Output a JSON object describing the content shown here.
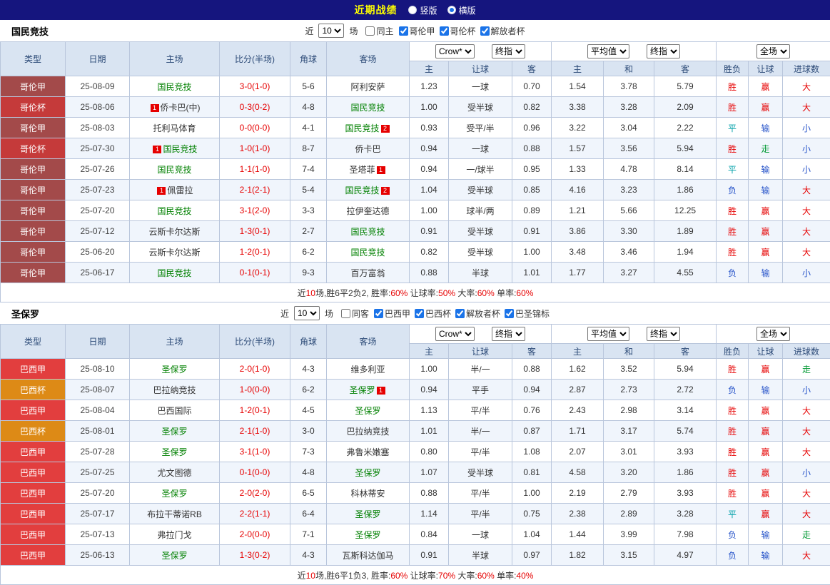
{
  "topbar": {
    "title": "近期战绩",
    "radios": [
      {
        "label": "竖版",
        "checked": false
      },
      {
        "label": "横版",
        "checked": true
      }
    ]
  },
  "colors": {
    "topbar_bg": "#15157E",
    "title_color": "#FFFF00",
    "focus_team": "#008000",
    "score": "#E60000",
    "league": {
      "哥伦甲": "#A34A4A",
      "哥伦杯": "#C53A3A",
      "巴西甲": "#E23E3E",
      "巴西杯": "#DD8A16"
    },
    "result": {
      "red": "#E60000",
      "blue": "#2653C9",
      "green": "#009933",
      "teal": "#00A0A8"
    }
  },
  "sections": [
    {
      "team": "国民竞技",
      "filter": {
        "prefix": "近",
        "count": "10",
        "suffix": "场",
        "same_label": "同主",
        "same_checked": false,
        "leagues": [
          {
            "label": "哥伦甲",
            "checked": true
          },
          {
            "label": "哥伦杯",
            "checked": true
          },
          {
            "label": "解放者杯",
            "checked": true
          }
        ]
      },
      "header": {
        "cols": [
          "类型",
          "日期",
          "主场",
          "比分(半场)",
          "角球",
          "客场"
        ],
        "group1": {
          "select1": "Crow*",
          "select2": "终指",
          "cols": [
            "主",
            "让球",
            "客"
          ]
        },
        "group2": {
          "select1": "平均值",
          "select2": "终指",
          "cols": [
            "主",
            "和",
            "客"
          ]
        },
        "group3": {
          "select": "全场",
          "cols": [
            "胜负",
            "让球",
            "进球数"
          ]
        }
      },
      "rows": [
        {
          "league": "哥伦甲",
          "date": "25-08-09",
          "home": {
            "name": "国民竞技",
            "focus": true
          },
          "score": "3-0(1-0)",
          "corner": "5-6",
          "away": {
            "name": "阿利安萨",
            "focus": false
          },
          "odds1": [
            "1.23",
            "一球",
            "0.70"
          ],
          "odds2": [
            "1.54",
            "3.78",
            "5.79"
          ],
          "results": [
            "胜",
            "赢",
            "大"
          ]
        },
        {
          "league": "哥伦杯",
          "date": "25-08-06",
          "home": {
            "name": "侨卡巴(中)",
            "focus": false,
            "badge": {
              "text": "1",
              "pos": "before"
            }
          },
          "score": "0-3(0-2)",
          "corner": "4-8",
          "away": {
            "name": "国民竞技",
            "focus": true
          },
          "odds1": [
            "1.00",
            "受半球",
            "0.82"
          ],
          "odds2": [
            "3.38",
            "3.28",
            "2.09"
          ],
          "results": [
            "胜",
            "赢",
            "大"
          ]
        },
        {
          "league": "哥伦甲",
          "date": "25-08-03",
          "home": {
            "name": "托利马体育",
            "focus": false
          },
          "score": "0-0(0-0)",
          "corner": "4-1",
          "away": {
            "name": "国民竞技",
            "focus": true,
            "badge": {
              "text": "2",
              "pos": "after"
            }
          },
          "odds1": [
            "0.93",
            "受平/半",
            "0.96"
          ],
          "odds2": [
            "3.22",
            "3.04",
            "2.22"
          ],
          "results": [
            "平",
            "输",
            "小"
          ]
        },
        {
          "league": "哥伦杯",
          "date": "25-07-30",
          "home": {
            "name": "国民竞技",
            "focus": true,
            "badge": {
              "text": "1",
              "pos": "before"
            }
          },
          "score": "1-0(1-0)",
          "corner": "8-7",
          "away": {
            "name": "侨卡巴",
            "focus": false
          },
          "odds1": [
            "0.94",
            "一球",
            "0.88"
          ],
          "odds2": [
            "1.57",
            "3.56",
            "5.94"
          ],
          "results": [
            "胜",
            "走",
            "小"
          ]
        },
        {
          "league": "哥伦甲",
          "date": "25-07-26",
          "home": {
            "name": "国民竞技",
            "focus": true
          },
          "score": "1-1(1-0)",
          "corner": "7-4",
          "away": {
            "name": "圣塔菲",
            "focus": false,
            "badge": {
              "text": "1",
              "pos": "after"
            }
          },
          "odds1": [
            "0.94",
            "一/球半",
            "0.95"
          ],
          "odds2": [
            "1.33",
            "4.78",
            "8.14"
          ],
          "results": [
            "平",
            "输",
            "小"
          ]
        },
        {
          "league": "哥伦甲",
          "date": "25-07-23",
          "home": {
            "name": "佩雷拉",
            "focus": false,
            "badge": {
              "text": "1",
              "pos": "before"
            }
          },
          "score": "2-1(2-1)",
          "corner": "5-4",
          "away": {
            "name": "国民竞技",
            "focus": true,
            "badge": {
              "text": "2",
              "pos": "after"
            }
          },
          "odds1": [
            "1.04",
            "受半球",
            "0.85"
          ],
          "odds2": [
            "4.16",
            "3.23",
            "1.86"
          ],
          "results": [
            "负",
            "输",
            "大"
          ]
        },
        {
          "league": "哥伦甲",
          "date": "25-07-20",
          "home": {
            "name": "国民竞技",
            "focus": true
          },
          "score": "3-1(2-0)",
          "corner": "3-3",
          "away": {
            "name": "拉伊奎达德",
            "focus": false
          },
          "odds1": [
            "1.00",
            "球半/两",
            "0.89"
          ],
          "odds2": [
            "1.21",
            "5.66",
            "12.25"
          ],
          "results": [
            "胜",
            "赢",
            "大"
          ]
        },
        {
          "league": "哥伦甲",
          "date": "25-07-12",
          "home": {
            "name": "云斯卡尔达斯",
            "focus": false
          },
          "score": "1-3(0-1)",
          "corner": "2-7",
          "away": {
            "name": "国民竞技",
            "focus": true
          },
          "odds1": [
            "0.91",
            "受半球",
            "0.91"
          ],
          "odds2": [
            "3.86",
            "3.30",
            "1.89"
          ],
          "results": [
            "胜",
            "赢",
            "大"
          ]
        },
        {
          "league": "哥伦甲",
          "date": "25-06-20",
          "home": {
            "name": "云斯卡尔达斯",
            "focus": false
          },
          "score": "1-2(0-1)",
          "corner": "6-2",
          "away": {
            "name": "国民竞技",
            "focus": true
          },
          "odds1": [
            "0.82",
            "受半球",
            "1.00"
          ],
          "odds2": [
            "3.48",
            "3.46",
            "1.94"
          ],
          "results": [
            "胜",
            "赢",
            "大"
          ]
        },
        {
          "league": "哥伦甲",
          "date": "25-06-17",
          "home": {
            "name": "国民竞技",
            "focus": true
          },
          "score": "0-1(0-1)",
          "corner": "9-3",
          "away": {
            "name": "百万富翁",
            "focus": false
          },
          "odds1": [
            "0.88",
            "半球",
            "1.01"
          ],
          "odds2": [
            "1.77",
            "3.27",
            "4.55"
          ],
          "results": [
            "负",
            "输",
            "小"
          ]
        }
      ],
      "summary": [
        {
          "text": "近"
        },
        {
          "text": "10",
          "red": true
        },
        {
          "text": "场,胜6平2负2, 胜率:"
        },
        {
          "text": "60%",
          "red": true
        },
        {
          "text": " 让球率:"
        },
        {
          "text": "50%",
          "red": true
        },
        {
          "text": " 大率:"
        },
        {
          "text": "60%",
          "red": true
        },
        {
          "text": " 单率:"
        },
        {
          "text": "60%",
          "red": true
        }
      ]
    },
    {
      "team": "圣保罗",
      "filter": {
        "prefix": "近",
        "count": "10",
        "suffix": "场",
        "same_label": "同客",
        "same_checked": false,
        "leagues": [
          {
            "label": "巴西甲",
            "checked": true
          },
          {
            "label": "巴西杯",
            "checked": true
          },
          {
            "label": "解放者杯",
            "checked": true
          },
          {
            "label": "巴圣锦标",
            "checked": true
          }
        ]
      },
      "header": {
        "cols": [
          "类型",
          "日期",
          "主场",
          "比分(半场)",
          "角球",
          "客场"
        ],
        "group1": {
          "select1": "Crow*",
          "select2": "终指",
          "cols": [
            "主",
            "让球",
            "客"
          ]
        },
        "group2": {
          "select1": "平均值",
          "select2": "终指",
          "cols": [
            "主",
            "和",
            "客"
          ]
        },
        "group3": {
          "select": "全场",
          "cols": [
            "胜负",
            "让球",
            "进球数"
          ]
        }
      },
      "rows": [
        {
          "league": "巴西甲",
          "date": "25-08-10",
          "home": {
            "name": "圣保罗",
            "focus": true
          },
          "score": "2-0(1-0)",
          "corner": "4-3",
          "away": {
            "name": "维多利亚",
            "focus": false
          },
          "odds1": [
            "1.00",
            "半/一",
            "0.88"
          ],
          "odds2": [
            "1.62",
            "3.52",
            "5.94"
          ],
          "results": [
            "胜",
            "赢",
            "走"
          ]
        },
        {
          "league": "巴西杯",
          "date": "25-08-07",
          "home": {
            "name": "巴拉纳竞技",
            "focus": false
          },
          "score": "1-0(0-0)",
          "corner": "6-2",
          "away": {
            "name": "圣保罗",
            "focus": true,
            "badge": {
              "text": "1",
              "pos": "after"
            }
          },
          "odds1": [
            "0.94",
            "平手",
            "0.94"
          ],
          "odds2": [
            "2.87",
            "2.73",
            "2.72"
          ],
          "results": [
            "负",
            "输",
            "小"
          ]
        },
        {
          "league": "巴西甲",
          "date": "25-08-04",
          "home": {
            "name": "巴西国际",
            "focus": false
          },
          "score": "1-2(0-1)",
          "corner": "4-5",
          "away": {
            "name": "圣保罗",
            "focus": true
          },
          "odds1": [
            "1.13",
            "平/半",
            "0.76"
          ],
          "odds2": [
            "2.43",
            "2.98",
            "3.14"
          ],
          "results": [
            "胜",
            "赢",
            "大"
          ]
        },
        {
          "league": "巴西杯",
          "date": "25-08-01",
          "home": {
            "name": "圣保罗",
            "focus": true
          },
          "score": "2-1(1-0)",
          "corner": "3-0",
          "away": {
            "name": "巴拉纳竞技",
            "focus": false
          },
          "odds1": [
            "1.01",
            "半/一",
            "0.87"
          ],
          "odds2": [
            "1.71",
            "3.17",
            "5.74"
          ],
          "results": [
            "胜",
            "赢",
            "大"
          ]
        },
        {
          "league": "巴西甲",
          "date": "25-07-28",
          "home": {
            "name": "圣保罗",
            "focus": true
          },
          "score": "3-1(1-0)",
          "corner": "7-3",
          "away": {
            "name": "弗鲁米嫩塞",
            "focus": false
          },
          "odds1": [
            "0.80",
            "平/半",
            "1.08"
          ],
          "odds2": [
            "2.07",
            "3.01",
            "3.93"
          ],
          "results": [
            "胜",
            "赢",
            "大"
          ]
        },
        {
          "league": "巴西甲",
          "date": "25-07-25",
          "home": {
            "name": "尤文图德",
            "focus": false
          },
          "score": "0-1(0-0)",
          "corner": "4-8",
          "away": {
            "name": "圣保罗",
            "focus": true
          },
          "odds1": [
            "1.07",
            "受半球",
            "0.81"
          ],
          "odds2": [
            "4.58",
            "3.20",
            "1.86"
          ],
          "results": [
            "胜",
            "赢",
            "小"
          ]
        },
        {
          "league": "巴西甲",
          "date": "25-07-20",
          "home": {
            "name": "圣保罗",
            "focus": true
          },
          "score": "2-0(2-0)",
          "corner": "6-5",
          "away": {
            "name": "科林蒂安",
            "focus": false
          },
          "odds1": [
            "0.88",
            "平/半",
            "1.00"
          ],
          "odds2": [
            "2.19",
            "2.79",
            "3.93"
          ],
          "results": [
            "胜",
            "赢",
            "大"
          ]
        },
        {
          "league": "巴西甲",
          "date": "25-07-17",
          "home": {
            "name": "布拉干蒂诺RB",
            "focus": false
          },
          "score": "2-2(1-1)",
          "corner": "6-4",
          "away": {
            "name": "圣保罗",
            "focus": true
          },
          "odds1": [
            "1.14",
            "平/半",
            "0.75"
          ],
          "odds2": [
            "2.38",
            "2.89",
            "3.28"
          ],
          "results": [
            "平",
            "赢",
            "大"
          ]
        },
        {
          "league": "巴西甲",
          "date": "25-07-13",
          "home": {
            "name": "弗拉门戈",
            "focus": false
          },
          "score": "2-0(0-0)",
          "corner": "7-1",
          "away": {
            "name": "圣保罗",
            "focus": true
          },
          "odds1": [
            "0.84",
            "一球",
            "1.04"
          ],
          "odds2": [
            "1.44",
            "3.99",
            "7.98"
          ],
          "results": [
            "负",
            "输",
            "走"
          ]
        },
        {
          "league": "巴西甲",
          "date": "25-06-13",
          "home": {
            "name": "圣保罗",
            "focus": true
          },
          "score": "1-3(0-2)",
          "corner": "4-3",
          "away": {
            "name": "瓦斯科达伽马",
            "focus": false
          },
          "odds1": [
            "0.91",
            "半球",
            "0.97"
          ],
          "odds2": [
            "1.82",
            "3.15",
            "4.97"
          ],
          "results": [
            "负",
            "输",
            "大"
          ]
        }
      ],
      "summary": [
        {
          "text": "近"
        },
        {
          "text": "10",
          "red": true
        },
        {
          "text": "场,胜6平1负3, 胜率:"
        },
        {
          "text": "60%",
          "red": true
        },
        {
          "text": " 让球率:"
        },
        {
          "text": "70%",
          "red": true
        },
        {
          "text": " 大率:"
        },
        {
          "text": "60%",
          "red": true
        },
        {
          "text": " 单率:"
        },
        {
          "text": "40%",
          "red": true
        }
      ]
    }
  ]
}
